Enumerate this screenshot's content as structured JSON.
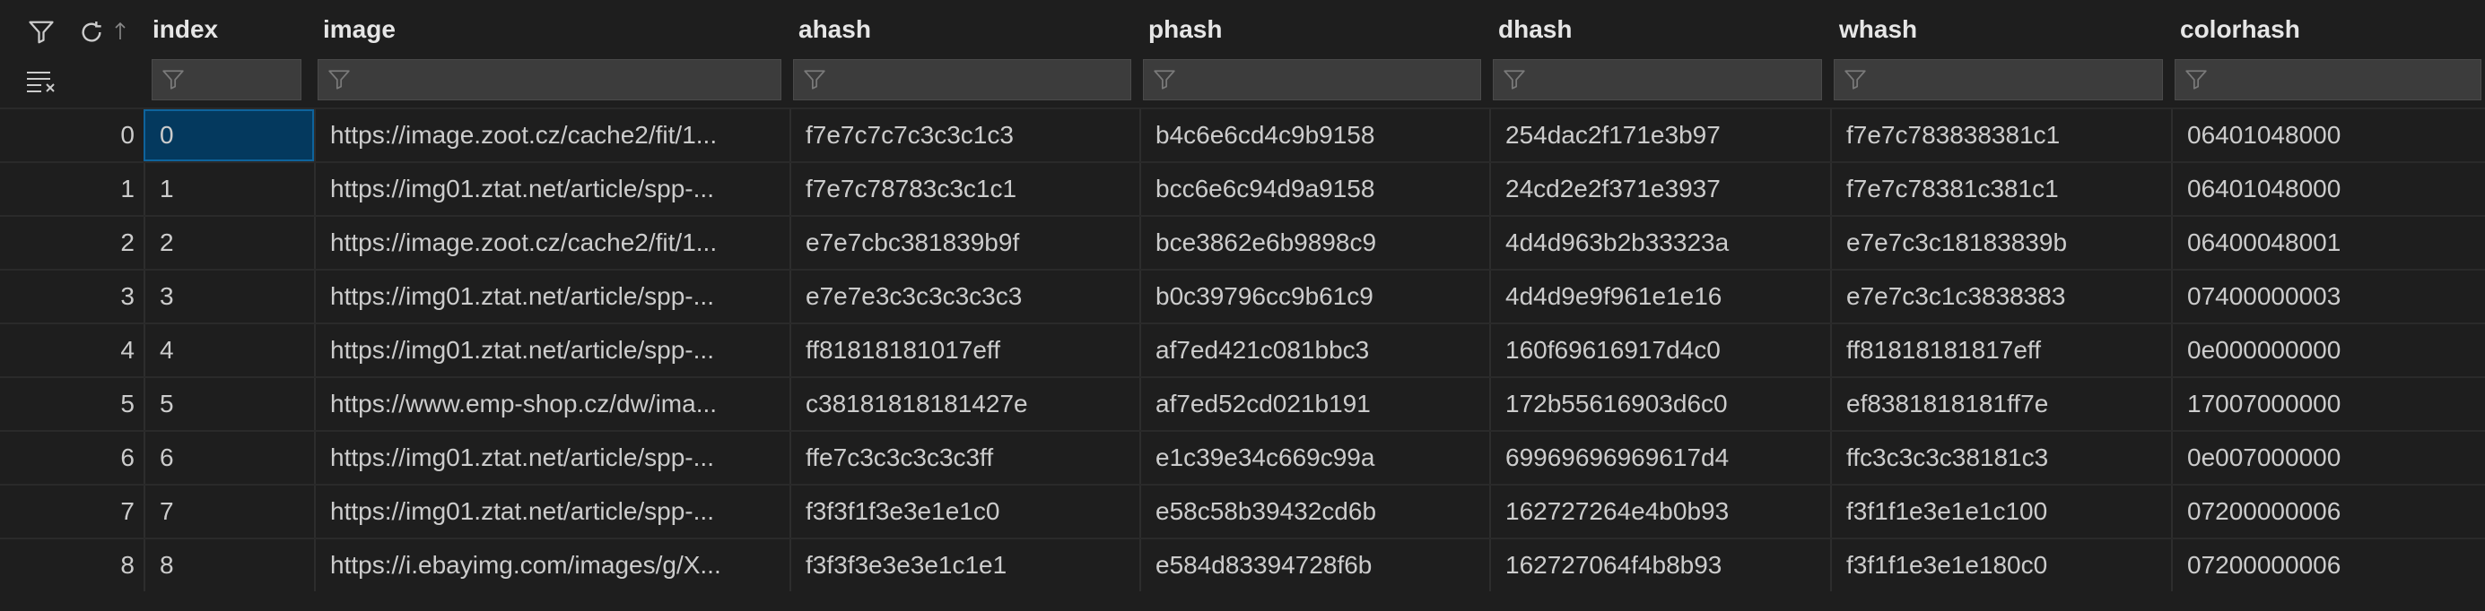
{
  "columns": [
    {
      "label": "index"
    },
    {
      "label": "image"
    },
    {
      "label": "ahash"
    },
    {
      "label": "phash"
    },
    {
      "label": "dhash"
    },
    {
      "label": "whash"
    },
    {
      "label": "colorhash"
    }
  ],
  "toolbar": {
    "filter_icon": "filter-icon",
    "refresh_icon": "refresh-icon",
    "sort_icon": "sort-arrow-icon",
    "clear_filters_icon": "clear-filters-icon"
  },
  "rows": [
    {
      "num": "0",
      "cells": [
        "0",
        "https://image.zoot.cz/cache2/fit/1...",
        "f7e7c7c7c3c3c1c3",
        "b4c6e6cd4c9b9158",
        "254dac2f171e3b97",
        "f7e7c783838381c1",
        "06401048000"
      ]
    },
    {
      "num": "1",
      "cells": [
        "1",
        "https://img01.ztat.net/article/spp-...",
        "f7e7c78783c3c1c1",
        "bcc6e6c94d9a9158",
        "24cd2e2f371e3937",
        "f7e7c78381c381c1",
        "06401048000"
      ]
    },
    {
      "num": "2",
      "cells": [
        "2",
        "https://image.zoot.cz/cache2/fit/1...",
        "e7e7cbc381839b9f",
        "bce3862e6b9898c9",
        "4d4d963b2b33323a",
        "e7e7c3c18183839b",
        "06400048001"
      ]
    },
    {
      "num": "3",
      "cells": [
        "3",
        "https://img01.ztat.net/article/spp-...",
        "e7e7e3c3c3c3c3c3",
        "b0c39796cc9b61c9",
        "4d4d9e9f961e1e16",
        "e7e7c3c1c3838383",
        "07400000003"
      ]
    },
    {
      "num": "4",
      "cells": [
        "4",
        "https://img01.ztat.net/article/spp-...",
        "ff81818181017eff",
        "af7ed421c081bbc3",
        "160f69616917d4c0",
        "ff81818181817eff",
        "0e000000000"
      ]
    },
    {
      "num": "5",
      "cells": [
        "5",
        "https://www.emp-shop.cz/dw/ima...",
        "c38181818181427e",
        "af7ed52cd021b191",
        "172b55616903d6c0",
        "ef8381818181ff7e",
        "17007000000"
      ]
    },
    {
      "num": "6",
      "cells": [
        "6",
        "https://img01.ztat.net/article/spp-...",
        "ffe7c3c3c3c3c3ff",
        "e1c39e34c669c99a",
        "69969696969617d4",
        "ffc3c3c3c38181c3",
        "0e007000000"
      ]
    },
    {
      "num": "7",
      "cells": [
        "7",
        "https://img01.ztat.net/article/spp-...",
        "f3f3f1f3e3e1e1c0",
        "e58c58b39432cd6b",
        "162727264e4b0b93",
        "f3f1f1e3e1e1c100",
        "07200000006"
      ]
    },
    {
      "num": "8",
      "cells": [
        "8",
        "https://i.ebayimg.com/images/g/X...",
        "f3f3f3e3e3e1c1e1",
        "e584d83394728f6b",
        "162727064f4b8b93",
        "f3f1f1e3e1e180c0",
        "07200000006"
      ]
    }
  ]
}
